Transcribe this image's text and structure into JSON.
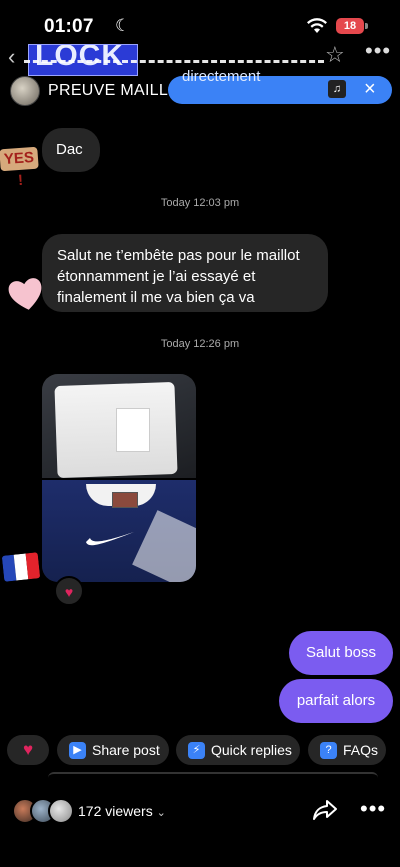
{
  "status_bar": {
    "time": "01:07",
    "battery": "18"
  },
  "header": {
    "art_text": "LOCK",
    "title": "PREUVE MAILLOT"
  },
  "music_pill": {
    "text": "directement",
    "close_label": "×"
  },
  "stickers": {
    "yes": "YES !"
  },
  "messages": {
    "m1": "Dac",
    "ts1": "Today 12:03 pm",
    "m2": "Salut ne t’embête pas pour le maillot étonnamment je l’ai essayé et finalement il me va bien ça va",
    "ts2": "Today 12:26 pm",
    "m3": "Salut boss",
    "m4": "parfait alors"
  },
  "reaction_heart": "♥",
  "chips": {
    "heart": "♥",
    "share_post": "Share post",
    "quick_replies": "Quick replies",
    "faqs": "FAQs"
  },
  "bottom": {
    "viewers": "172 viewers",
    "more": "•••"
  },
  "colors": {
    "outgoing_bubble": "#7b5cf0",
    "incoming_bubble": "#262626",
    "music_pill": "#3b82f6",
    "accent_heart": "#e0245e"
  },
  "icons": [
    "moon-icon",
    "wifi-icon",
    "battery-icon",
    "back-icon",
    "star-icon",
    "more-icon",
    "music-note-icon",
    "close-icon",
    "play-icon",
    "lightning-icon",
    "question-icon",
    "share-icon",
    "chevron-down-icon"
  ]
}
